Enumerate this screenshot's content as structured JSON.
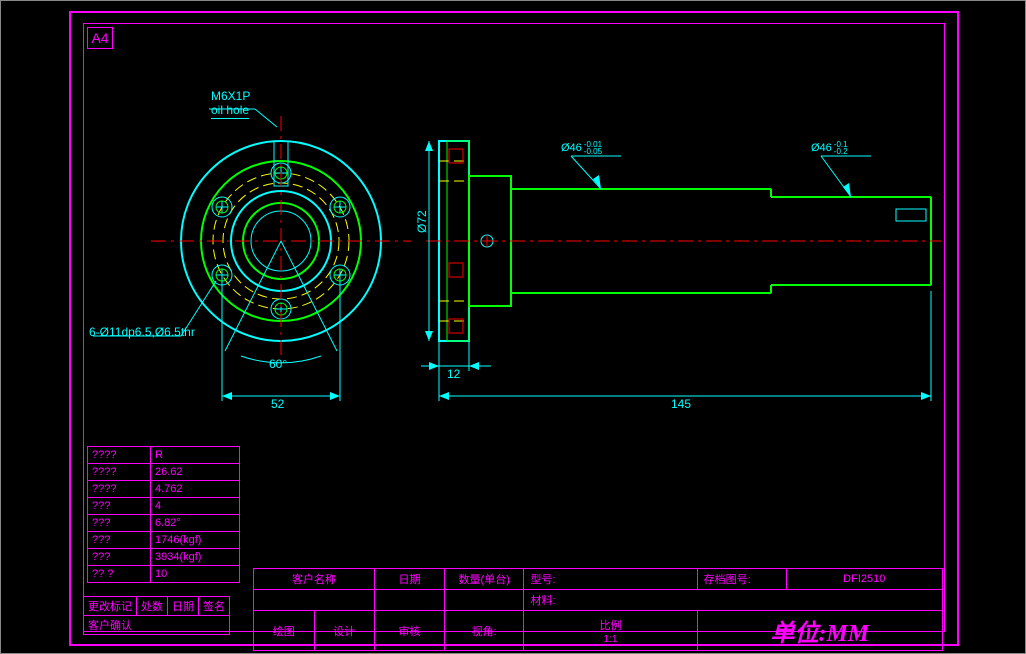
{
  "sheet": {
    "size_label": "A4"
  },
  "annotations": {
    "thread": "M6X1P",
    "thread_sub": "oil hole",
    "bolt_pattern": "6-Ø11dp6.5,Ø6.5thr",
    "angle": "60°",
    "bolt_circle_dia": "52",
    "shaft_dia_1": "Ø46 -0.01/-0.05",
    "shaft_dia_2": "Ø46 -0.1/-0.2",
    "flange_dia": "Ø72",
    "flange_thick": "12",
    "overall_len": "145"
  },
  "spec_rows": [
    {
      "k": "????",
      "v": "R"
    },
    {
      "k": "????",
      "v": "26.62"
    },
    {
      "k": "????",
      "v": "4.762"
    },
    {
      "k": "???",
      "v": "4"
    },
    {
      "k": "???",
      "v": "6.82°"
    },
    {
      "k": "???",
      "v": "1746(kgf)"
    },
    {
      "k": "???",
      "v": "3934(kgf)"
    },
    {
      "k": "?? ?",
      "v": "10"
    }
  ],
  "titleblock": {
    "row1": {
      "customer": "客户名称",
      "date": "日期",
      "qty": "数量(单台)",
      "model_label": "型号:",
      "archive_label": "存档图号:",
      "archive_no": "DFI2510"
    },
    "material_label": "材料:",
    "row2": {
      "draw": "绘图",
      "design": "设计",
      "check": "审核",
      "view": "视角:",
      "scale": "比例",
      "scale_val": "1:1"
    },
    "unit": "单位:MM",
    "rev": {
      "mark": "更改标记",
      "place": "处数",
      "date": "日期",
      "sign": "签名",
      "confirm": "客户确认"
    }
  }
}
